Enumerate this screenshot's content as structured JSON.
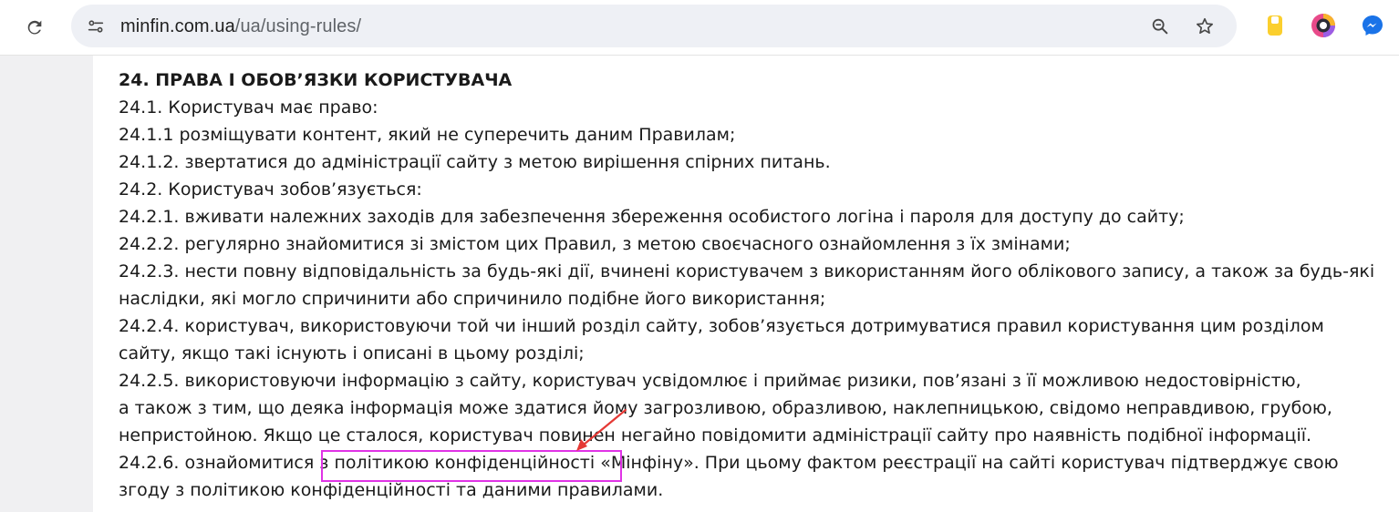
{
  "browser": {
    "url_host": "minfin.com.ua",
    "url_path": "/ua/using-rules/",
    "icons": [
      "reload-icon",
      "site-info-icon",
      "zoom-icon",
      "bookmark-star-icon",
      "extension-notes-icon",
      "extension-camera-icon",
      "extension-messenger-icon"
    ],
    "accent": "#e033e6"
  },
  "document": {
    "lines": [
      "24. ПРАВА І ОБОВ’ЯЗКИ КОРИСТУВАЧА",
      "24.1. Користувач має право:",
      "24.1.1 розміщувати контент, який не суперечить даним Правилам;",
      "24.1.2. звертатися до адміністрації сайту з метою вирішення спірних питань.",
      "24.2. Користувач зобов’язується:",
      "24.2.1. вживати належних заходів для забезпечення збереження особистого логіна і пароля для доступу до сайту;",
      "24.2.2. регулярно знайомитися зі змістом цих Правил, з метою своєчасного ознайомлення з їх змінами;",
      "24.2.3. нести повну відповідальність за будь-які дії, вчинені користувачем з використанням його облікового запису, а також за будь-які",
      "наслідки, які могло спричинити або спричинило подібне його використання;",
      "24.2.4. користувач, використовуючи той чи інший розділ сайту, зобов’язується дотримуватися правил користування цим розділом",
      "сайту, якщо такі існують і описані в цьому розділі;",
      "24.2.5. використовуючи інформацію з сайту, користувач усвідомлює і приймає ризики, пов’язані з її можливою недостовірністю,",
      "а також з тим, що деяка інформація може здатися йому загрозливою, образливою, наклепницькою, свідомо неправдивою, грубою,",
      "непристойною. Якщо це сталося, користувач повинен негайно повідомити адміністрації сайту про наявність подібної інформації.",
      "24.2.6. ознайомитися з політикою конфіденційності «Мінфіну». При цьому фактом реєстрації на сайті користувач підтверджує свою",
      "згоду з політикою конфіденційності та даними правилами."
    ],
    "line_2426_prefix": "24.2.6. ознайомитися ",
    "privacy_link": "з політикою конфіденційності",
    "line_2426_suffix": " «Мінфіну». При цьому фактом реєстрації на сайті користувач підтверджує свою"
  }
}
